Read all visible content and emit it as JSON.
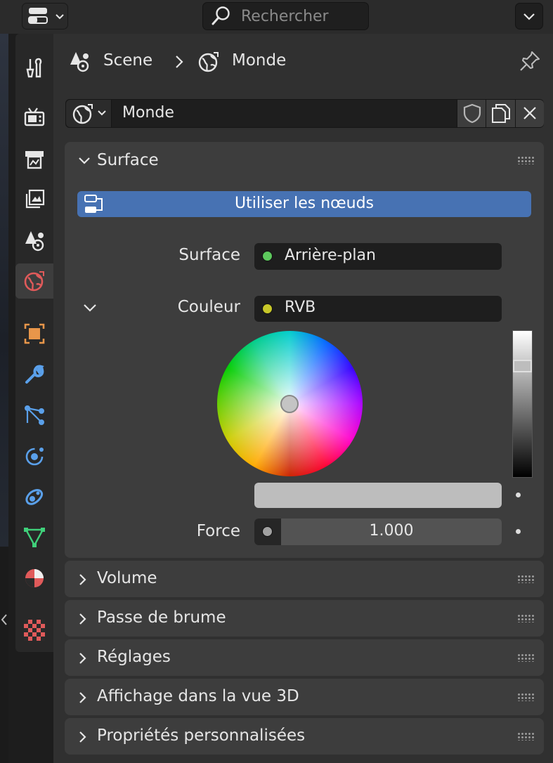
{
  "header": {
    "search_placeholder": "Rechercher"
  },
  "breadcrumb": {
    "scene": "Scene",
    "separator": ">",
    "world": "Monde"
  },
  "datablock": {
    "name": "Monde"
  },
  "surface_panel": {
    "title": "Surface",
    "use_nodes_label": "Utiliser les nœuds",
    "surface_label": "Surface",
    "surface_value": "Arrière-plan",
    "color_label": "Couleur",
    "color_value": "RVB",
    "strength_label": "Force",
    "strength_value": "1.000",
    "surface_socket_color": "#5dc85d",
    "color_socket_color": "#c7c729",
    "strength_socket_color": "#a1a1a1",
    "value_level": 0.78
  },
  "collapsed_panels": [
    {
      "title": "Volume"
    },
    {
      "title": "Passe de brume"
    },
    {
      "title": "Réglages"
    },
    {
      "title": "Affichage dans la vue 3D"
    },
    {
      "title": "Propriétés personnalisées"
    }
  ],
  "tabs": [
    {
      "name": "tool-icon"
    },
    {
      "name": "render-icon"
    },
    {
      "name": "output-icon"
    },
    {
      "name": "view-layer-icon"
    },
    {
      "name": "scene-icon"
    },
    {
      "name": "world-icon",
      "active": true
    },
    {
      "name": "object-icon"
    },
    {
      "name": "modifier-icon"
    },
    {
      "name": "particles-icon"
    },
    {
      "name": "physics-icon"
    },
    {
      "name": "constraints-icon"
    },
    {
      "name": "data-icon"
    },
    {
      "name": "material-icon"
    },
    {
      "name": "texture-icon"
    }
  ],
  "colors": {
    "accent": "#4772b3",
    "panel": "#3d3d3d",
    "background": "#303030"
  }
}
